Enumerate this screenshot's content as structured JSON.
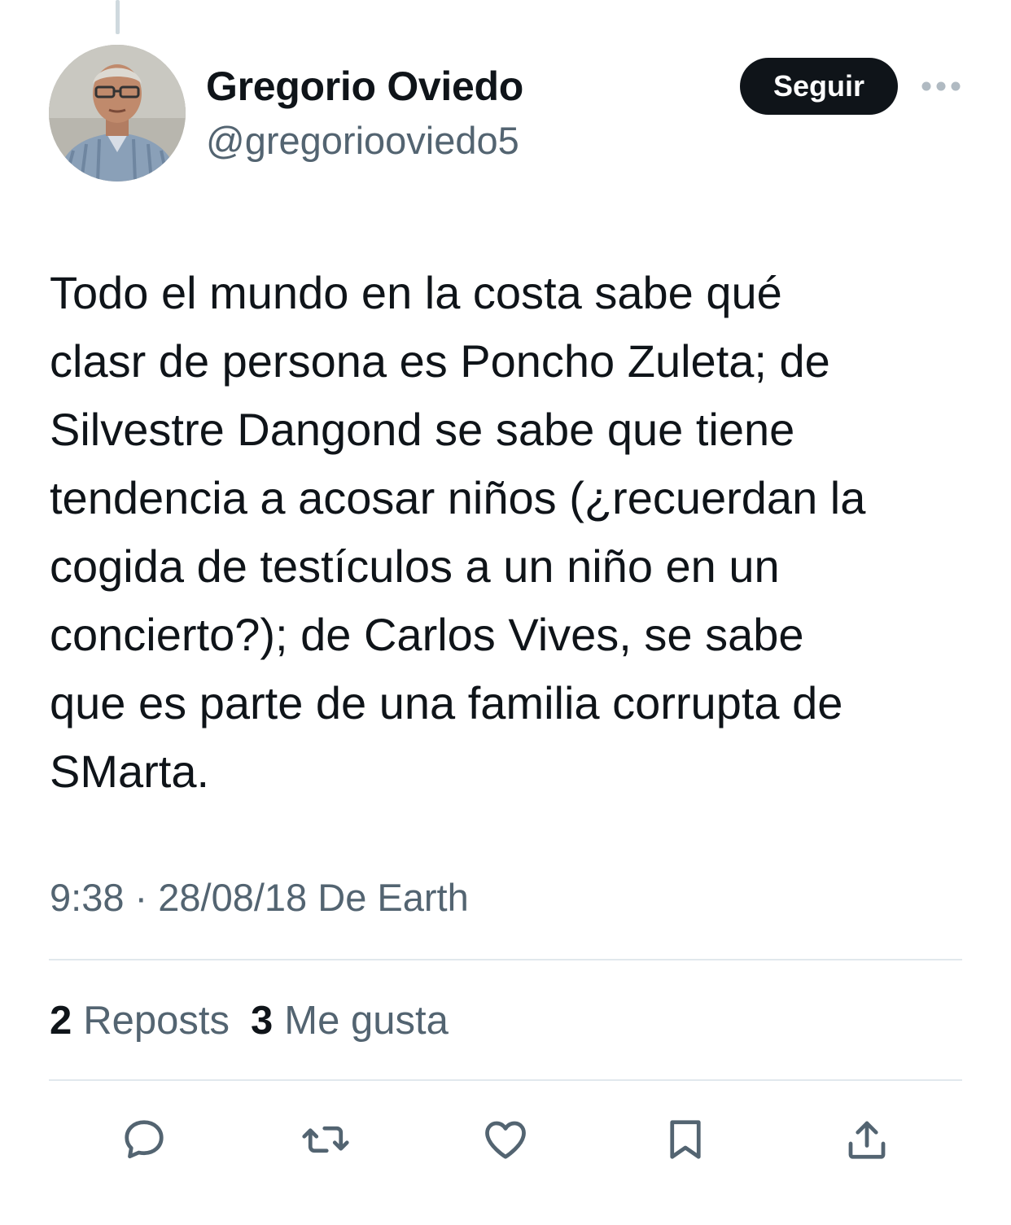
{
  "tweet": {
    "author": {
      "display_name": "Gregorio Oviedo",
      "handle": "@gregoriooviedo5"
    },
    "follow_label": "Seguir",
    "text_lines": [
      "Todo el mundo en la costa sabe qué",
      "clasr de persona es Poncho Zuleta; de",
      "Silvestre Dangond se sabe que tiene",
      "tendencia a acosar niños (¿recuerdan la",
      "cogida de testículos a un niño en un",
      "concierto?); de Carlos Vives, se sabe",
      "que es parte de una familia corrupta de",
      "SMarta."
    ],
    "meta": "9:38 · 28/08/18 De Earth",
    "stats": {
      "reposts_count": "2",
      "reposts_label": "Reposts",
      "likes_count": "3",
      "likes_label": "Me gusta"
    }
  },
  "icons": {
    "more": "more-dots-icon",
    "reply": "reply-icon",
    "repost": "repost-icon",
    "like": "heart-icon",
    "bookmark": "bookmark-icon",
    "share": "share-icon"
  },
  "colors": {
    "text_primary": "#0f1419",
    "text_secondary": "#536471",
    "button_bg": "#0f1419",
    "divider": "#e1e8ed"
  }
}
